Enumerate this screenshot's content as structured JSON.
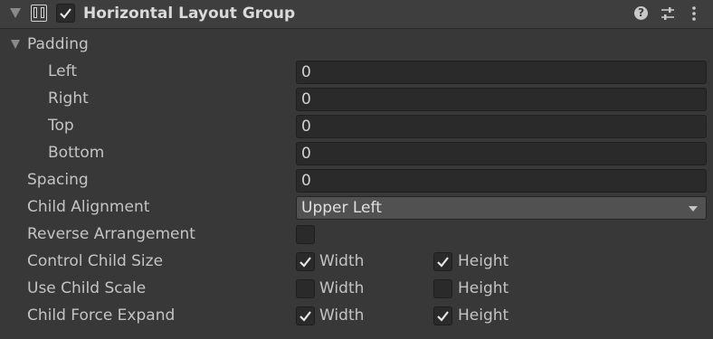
{
  "component": {
    "title": "Horizontal Layout Group",
    "enabled": true,
    "help_glyph": "?",
    "icons": [
      "foldout-arrow-icon",
      "layout-group-icon",
      "help-icon",
      "preset-sliders-icon",
      "kebab-menu-icon"
    ]
  },
  "padding": {
    "label": "Padding",
    "rows": [
      {
        "label": "Left",
        "value": "0"
      },
      {
        "label": "Right",
        "value": "0"
      },
      {
        "label": "Top",
        "value": "0"
      },
      {
        "label": "Bottom",
        "value": "0"
      }
    ]
  },
  "spacing": {
    "label": "Spacing",
    "value": "0"
  },
  "child_alignment": {
    "label": "Child Alignment",
    "value": "Upper Left"
  },
  "reverse_arrangement": {
    "label": "Reverse Arrangement",
    "checked": false
  },
  "toggle_labels": {
    "width": "Width",
    "height": "Height"
  },
  "control_child_size": {
    "label": "Control Child Size",
    "width": true,
    "height": true
  },
  "use_child_scale": {
    "label": "Use Child Scale",
    "width": false,
    "height": false
  },
  "child_force_expand": {
    "label": "Child Force Expand",
    "width": true,
    "height": true
  },
  "colors": {
    "background": "#383838",
    "header": "#3e3e3e",
    "field": "#2a2a2a",
    "text": "#c4c4c4"
  }
}
